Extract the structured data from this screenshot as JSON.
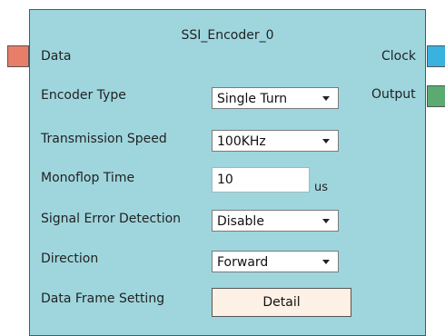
{
  "block": {
    "title": "SSI_Encoder_0"
  },
  "pins": {
    "data": {
      "label": "Data",
      "color": "#e87d6a"
    },
    "clock": {
      "label": "Clock",
      "color": "#3ab2e0"
    },
    "output": {
      "label": "Output",
      "color": "#5aaa72"
    }
  },
  "settings": {
    "encoder_type": {
      "label": "Encoder Type",
      "value": "Single Turn"
    },
    "transmission_speed": {
      "label": "Transmission Speed",
      "value": "100KHz"
    },
    "monoflop_time": {
      "label": "Monoflop Time",
      "value": "10",
      "unit": "us"
    },
    "signal_error_detection": {
      "label": "Signal Error Detection",
      "value": "Disable"
    },
    "direction": {
      "label": "Direction",
      "value": "Forward"
    },
    "data_frame_setting": {
      "label": "Data Frame Setting",
      "button": "Detail"
    }
  }
}
